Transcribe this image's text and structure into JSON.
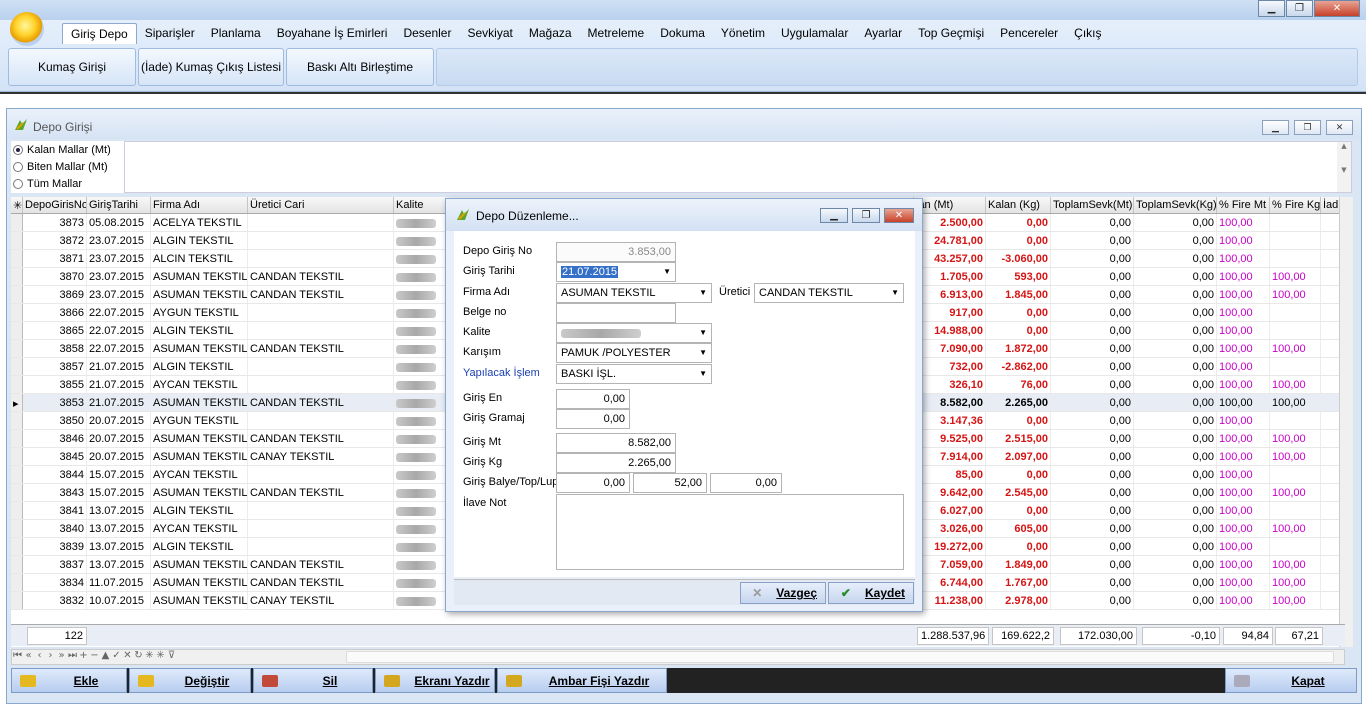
{
  "menu": [
    "Giriş Depo",
    "Siparişler",
    "Planlama",
    "Boyahane İş Emirleri",
    "Desenler",
    "Sevkiyat",
    "Mağaza",
    "Metreleme",
    "Dokuma",
    "Yönetim",
    "Uygulamalar",
    "Ayarlar",
    "Top Geçmişi",
    "Pencereler",
    "Çıkış"
  ],
  "ribbon_buttons": [
    "Kumaş Girişi",
    "(İade) Kumaş Çıkış Listesi",
    "Baskı Altı Birleştime"
  ],
  "window_title": "Depo Girişi",
  "filters": [
    "Kalan Mallar (Mt)",
    "Biten Mallar (Mt)",
    "Tüm Mallar"
  ],
  "columns": {
    "no": "DepoGirisNo",
    "tarih": "GirişTarihi",
    "firma": "Firma Adı",
    "uretici": "Üretici Cari",
    "kalite": "Kalite",
    "kalan_mt": "lan (Mt)",
    "kalan_kg": "Kalan (Kg)",
    "sevk_mt": "ToplamSevk(Mt)",
    "sevk_kg": "ToplamSevk(Kg)",
    "fire_mt": "% Fire Mt",
    "fire_kg": "% Fire Kg",
    "iade": "İad"
  },
  "rows": [
    {
      "no": "3873",
      "tarih": "05.08.2015",
      "firma": "ACELYA TEKSTIL",
      "uretici": "",
      "kmt": "2.500,00",
      "kkg": "0,00",
      "smt": "0,00",
      "skg": "0,00",
      "fmt": "100,00",
      "fkg": ""
    },
    {
      "no": "3872",
      "tarih": "23.07.2015",
      "firma": "ALGIN TEKSTIL",
      "uretici": "",
      "kmt": "24.781,00",
      "kkg": "0,00",
      "smt": "0,00",
      "skg": "0,00",
      "fmt": "100,00",
      "fkg": ""
    },
    {
      "no": "3871",
      "tarih": "23.07.2015",
      "firma": "ALCIN TEKSTIL",
      "uretici": "",
      "kmt": "43.257,00",
      "kkg": "-3.060,00",
      "smt": "0,00",
      "skg": "0,00",
      "fmt": "100,00",
      "fkg": ""
    },
    {
      "no": "3870",
      "tarih": "23.07.2015",
      "firma": "ASUMAN TEKSTIL",
      "uretici": "CANDAN TEKSTIL",
      "kmt": "1.705,00",
      "kkg": "593,00",
      "smt": "0,00",
      "skg": "0,00",
      "fmt": "100,00",
      "fkg": "100,00"
    },
    {
      "no": "3869",
      "tarih": "23.07.2015",
      "firma": "ASUMAN TEKSTIL",
      "uretici": "CANDAN TEKSTIL",
      "kmt": "6.913,00",
      "kkg": "1.845,00",
      "smt": "0,00",
      "skg": "0,00",
      "fmt": "100,00",
      "fkg": "100,00"
    },
    {
      "no": "3866",
      "tarih": "22.07.2015",
      "firma": "AYGUN TEKSTIL",
      "uretici": "",
      "kmt": "917,00",
      "kkg": "0,00",
      "smt": "0,00",
      "skg": "0,00",
      "fmt": "100,00",
      "fkg": ""
    },
    {
      "no": "3865",
      "tarih": "22.07.2015",
      "firma": "ALGIN TEKSTIL",
      "uretici": "",
      "kmt": "14.988,00",
      "kkg": "0,00",
      "smt": "0,00",
      "skg": "0,00",
      "fmt": "100,00",
      "fkg": ""
    },
    {
      "no": "3858",
      "tarih": "22.07.2015",
      "firma": "ASUMAN TEKSTIL",
      "uretici": "CANDAN TEKSTIL",
      "kmt": "7.090,00",
      "kkg": "1.872,00",
      "smt": "0,00",
      "skg": "0,00",
      "fmt": "100,00",
      "fkg": "100,00"
    },
    {
      "no": "3857",
      "tarih": "21.07.2015",
      "firma": "ALGIN TEKSTIL",
      "uretici": "",
      "kmt": "732,00",
      "kkg": "-2.862,00",
      "smt": "0,00",
      "skg": "0,00",
      "fmt": "100,00",
      "fkg": ""
    },
    {
      "no": "3855",
      "tarih": "21.07.2015",
      "firma": "AYCAN TEKSTIL",
      "uretici": "",
      "kmt": "326,10",
      "kkg": "76,00",
      "smt": "0,00",
      "skg": "0,00",
      "fmt": "100,00",
      "fkg": "100,00"
    },
    {
      "no": "3853",
      "tarih": "21.07.2015",
      "firma": "ASUMAN TEKSTIL",
      "uretici": "CANDAN TEKSTIL",
      "kmt": "8.582,00",
      "kkg": "2.265,00",
      "smt": "0,00",
      "skg": "0,00",
      "fmt": "100,00",
      "fkg": "100,00",
      "sel": true
    },
    {
      "no": "3850",
      "tarih": "20.07.2015",
      "firma": "AYGUN TEKSTIL",
      "uretici": "",
      "kmt": "3.147,36",
      "kkg": "0,00",
      "smt": "0,00",
      "skg": "0,00",
      "fmt": "100,00",
      "fkg": ""
    },
    {
      "no": "3846",
      "tarih": "20.07.2015",
      "firma": "ASUMAN TEKSTIL",
      "uretici": "CANDAN TEKSTIL",
      "kmt": "9.525,00",
      "kkg": "2.515,00",
      "smt": "0,00",
      "skg": "0,00",
      "fmt": "100,00",
      "fkg": "100,00"
    },
    {
      "no": "3845",
      "tarih": "20.07.2015",
      "firma": "ASUMAN TEKSTIL",
      "uretici": "CANAY TEKSTIL",
      "kmt": "7.914,00",
      "kkg": "2.097,00",
      "smt": "0,00",
      "skg": "0,00",
      "fmt": "100,00",
      "fkg": "100,00"
    },
    {
      "no": "3844",
      "tarih": "15.07.2015",
      "firma": "AYCAN TEKSTIL",
      "uretici": "",
      "kmt": "85,00",
      "kkg": "0,00",
      "smt": "0,00",
      "skg": "0,00",
      "fmt": "100,00",
      "fkg": ""
    },
    {
      "no": "3843",
      "tarih": "15.07.2015",
      "firma": "ASUMAN TEKSTIL",
      "uretici": "CANDAN TEKSTIL",
      "kmt": "9.642,00",
      "kkg": "2.545,00",
      "smt": "0,00",
      "skg": "0,00",
      "fmt": "100,00",
      "fkg": "100,00"
    },
    {
      "no": "3841",
      "tarih": "13.07.2015",
      "firma": "ALGIN TEKSTIL",
      "uretici": "",
      "kmt": "6.027,00",
      "kkg": "0,00",
      "smt": "0,00",
      "skg": "0,00",
      "fmt": "100,00",
      "fkg": ""
    },
    {
      "no": "3840",
      "tarih": "13.07.2015",
      "firma": "AYCAN TEKSTIL",
      "uretici": "",
      "kmt": "3.026,00",
      "kkg": "605,00",
      "smt": "0,00",
      "skg": "0,00",
      "fmt": "100,00",
      "fkg": "100,00"
    },
    {
      "no": "3839",
      "tarih": "13.07.2015",
      "firma": "ALGIN TEKSTIL",
      "uretici": "",
      "kmt": "19.272,00",
      "kkg": "0,00",
      "smt": "0,00",
      "skg": "0,00",
      "fmt": "100,00",
      "fkg": ""
    },
    {
      "no": "3837",
      "tarih": "13.07.2015",
      "firma": "ASUMAN TEKSTIL",
      "uretici": "CANDAN TEKSTIL",
      "kmt": "7.059,00",
      "kkg": "1.849,00",
      "smt": "0,00",
      "skg": "0,00",
      "fmt": "100,00",
      "fkg": "100,00"
    },
    {
      "no": "3834",
      "tarih": "11.07.2015",
      "firma": "ASUMAN TEKSTIL",
      "uretici": "CANDAN TEKSTIL",
      "kmt": "6.744,00",
      "kkg": "1.767,00",
      "smt": "0,00",
      "skg": "0,00",
      "fmt": "100,00",
      "fkg": "100,00"
    },
    {
      "no": "3832",
      "tarih": "10.07.2015",
      "firma": "ASUMAN TEKSTIL",
      "uretici": "CANAY TEKSTIL",
      "kmt": "11.238,00",
      "kkg": "2.978,00",
      "smt": "0,00",
      "skg": "0,00",
      "fmt": "100,00",
      "fkg": "100,00"
    }
  ],
  "footer": {
    "count": "122",
    "kmt": "1.288.537,96",
    "kkg": "169.622,2",
    "smt": "172.030,00",
    "skg": "-0,10",
    "fmt": "94,84",
    "fkg": "67,21"
  },
  "actions": {
    "ekle": "Ekle",
    "degistir": "Değiştir",
    "sil": "Sil",
    "ekran": "Ekranı Yazdır",
    "ambar": "Ambar Fişi Yazdır",
    "kapat": "Kapat"
  },
  "dialog": {
    "title": "Depo Düzenleme...",
    "labels": {
      "no": "Depo Giriş No",
      "tarih": "Giriş Tarihi",
      "firma": "Firma Adı",
      "uretici": "Üretici",
      "belge": "Belge no",
      "kalite": "Kalite",
      "karisim": "Karışım",
      "islem": "Yapılacak İşlem",
      "en": "Giriş En",
      "gramaj": "Giriş Gramaj",
      "mt": "Giriş Mt",
      "kg": "Giriş Kg",
      "balye": "Giriş Balye/Top/Lup",
      "not": "İlave Not"
    },
    "values": {
      "no": "3.853,00",
      "tarih": "21.07.2015",
      "firma": "ASUMAN TEKSTIL",
      "uretici": "CANDAN TEKSTIL",
      "belge": "",
      "karisim": "PAMUK /POLYESTER",
      "islem": "BASKI İŞL.",
      "en": "0,00",
      "gramaj": "0,00",
      "mt": "8.582,00",
      "kg": "2.265,00",
      "balye": "0,00",
      "top": "52,00",
      "lup": "0,00"
    },
    "vazgec": "Vazgeç",
    "kaydet": "Kaydet"
  }
}
